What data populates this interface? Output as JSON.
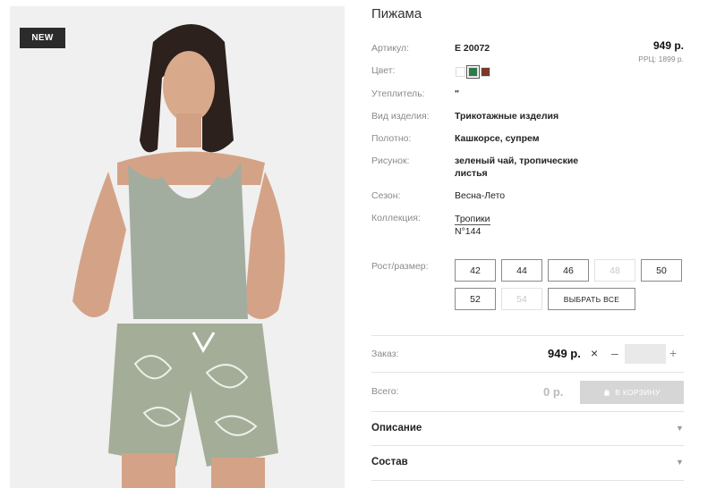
{
  "product": {
    "badge": "NEW",
    "title": "Пижама",
    "price": "949 р.",
    "rrp": "РРЦ: 1899 р."
  },
  "details": {
    "article_label": "Артикул:",
    "article_value": "Е 20072",
    "color_label": "Цвет:",
    "colors": [
      "#ffffff",
      "#2f7a48",
      "#7a3a2a"
    ],
    "selected_color_index": 1,
    "insulation_label": "Утеплитель:",
    "insulation_value": "\"",
    "type_label": "Вид изделия:",
    "type_value": "Трикотажные изделия",
    "fabric_label": "Полотно:",
    "fabric_value": "Кашкорсе, супрем",
    "pattern_label": "Рисунок:",
    "pattern_line1": "зеленый чай, тропические",
    "pattern_line2": "листья",
    "season_label": "Сезон:",
    "season_value": "Весна-Лето",
    "collection_label": "Коллекция:",
    "collection_link": "Тропики",
    "collection_number": "N°144"
  },
  "sizes": {
    "label": "Рост/размер:",
    "items": [
      {
        "label": "42",
        "available": true
      },
      {
        "label": "44",
        "available": true
      },
      {
        "label": "46",
        "available": true
      },
      {
        "label": "48",
        "available": false
      },
      {
        "label": "50",
        "available": true
      },
      {
        "label": "52",
        "available": true
      },
      {
        "label": "54",
        "available": false
      }
    ],
    "select_all": "ВЫБРАТЬ ВСЕ"
  },
  "order": {
    "label": "Заказ:",
    "price": "949 р.",
    "times": "×",
    "minus": "–",
    "plus": "+",
    "quantity": ""
  },
  "total": {
    "label": "Всего:",
    "value": "0 р.",
    "cart_button": "В КОРЗИНУ"
  },
  "accordion": {
    "description": "Описание",
    "composition": "Состав"
  }
}
